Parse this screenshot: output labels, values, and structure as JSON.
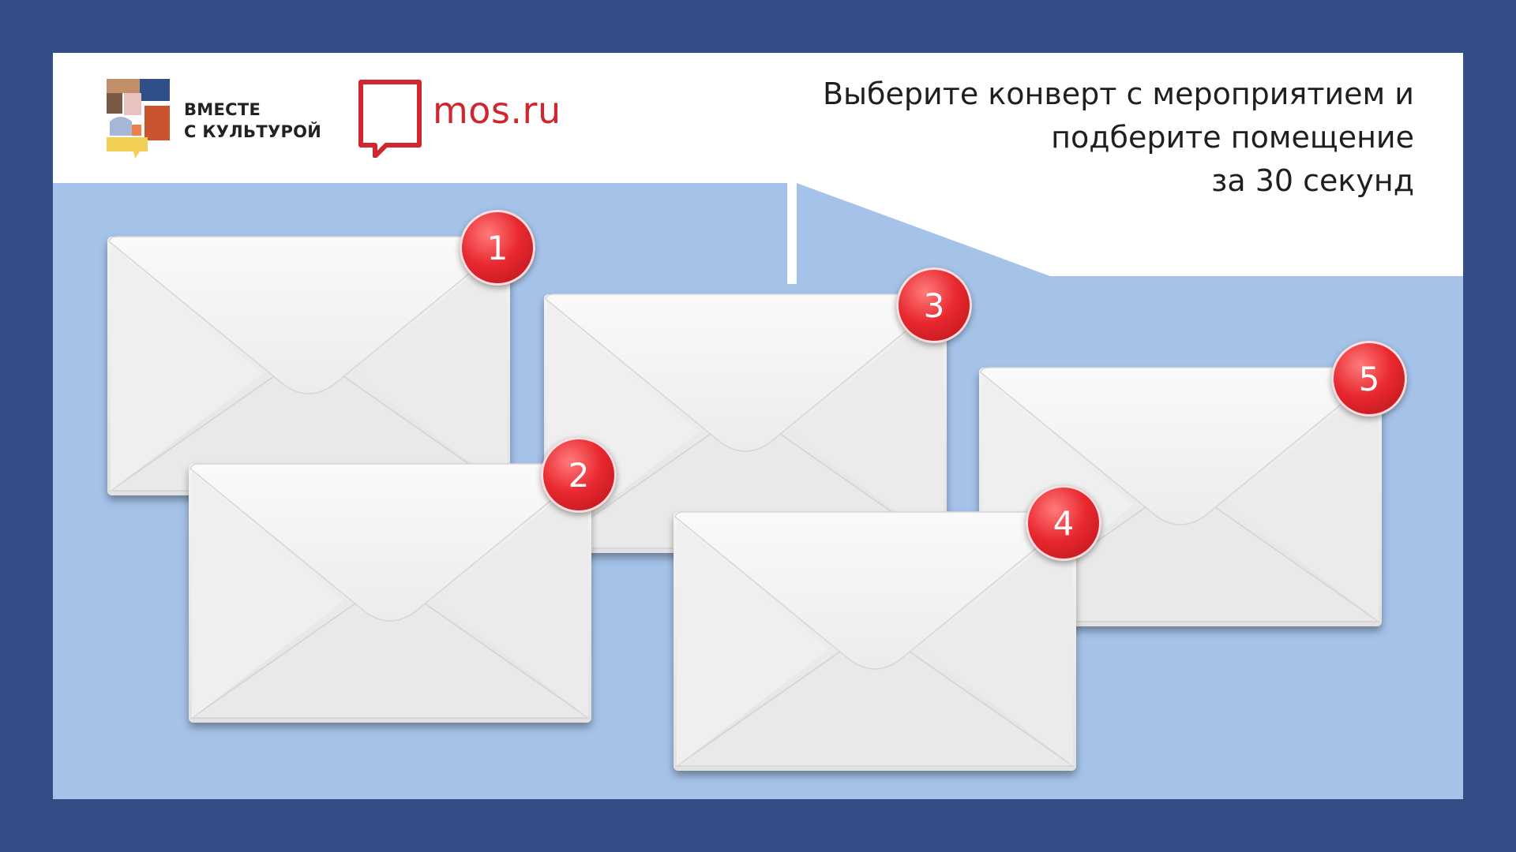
{
  "header": {
    "brand_vk_line1": "ВМЕСТЕ",
    "brand_vk_line2": "С КУЛЬТУРОЙ",
    "brand_mos": "mos.ru",
    "instruction_line1": "Выберите конверт с мероприятием и",
    "instruction_line2": "подберите помещение",
    "instruction_line3": "за 30 секунд"
  },
  "envelopes": [
    {
      "number": "1"
    },
    {
      "number": "2"
    },
    {
      "number": "3"
    },
    {
      "number": "4"
    },
    {
      "number": "5"
    }
  ],
  "colors": {
    "frame": "#334d86",
    "panel": "#a5c2e9",
    "badge": "#e8282f",
    "mos_red": "#d0262d"
  }
}
